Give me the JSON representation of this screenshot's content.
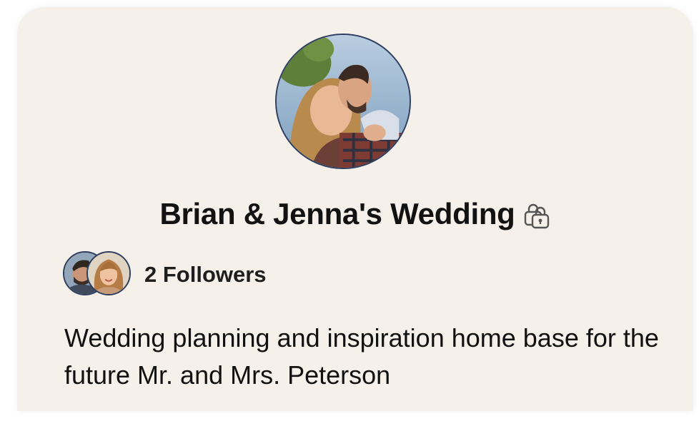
{
  "board": {
    "title": "Brian & Jenna's Wedding",
    "privacy_icon": "lock-icon",
    "followers_label": "2 Followers",
    "description": "Wedding planning and inspiration home base for the future Mr. and Mrs. Peterson",
    "cover_image": "couple-photo",
    "follower_avatars": [
      "man-avatar",
      "woman-avatar"
    ]
  },
  "colors": {
    "card_background": "#f6f0ea",
    "avatar_border": "#2d3d5f",
    "text": "#111111"
  }
}
